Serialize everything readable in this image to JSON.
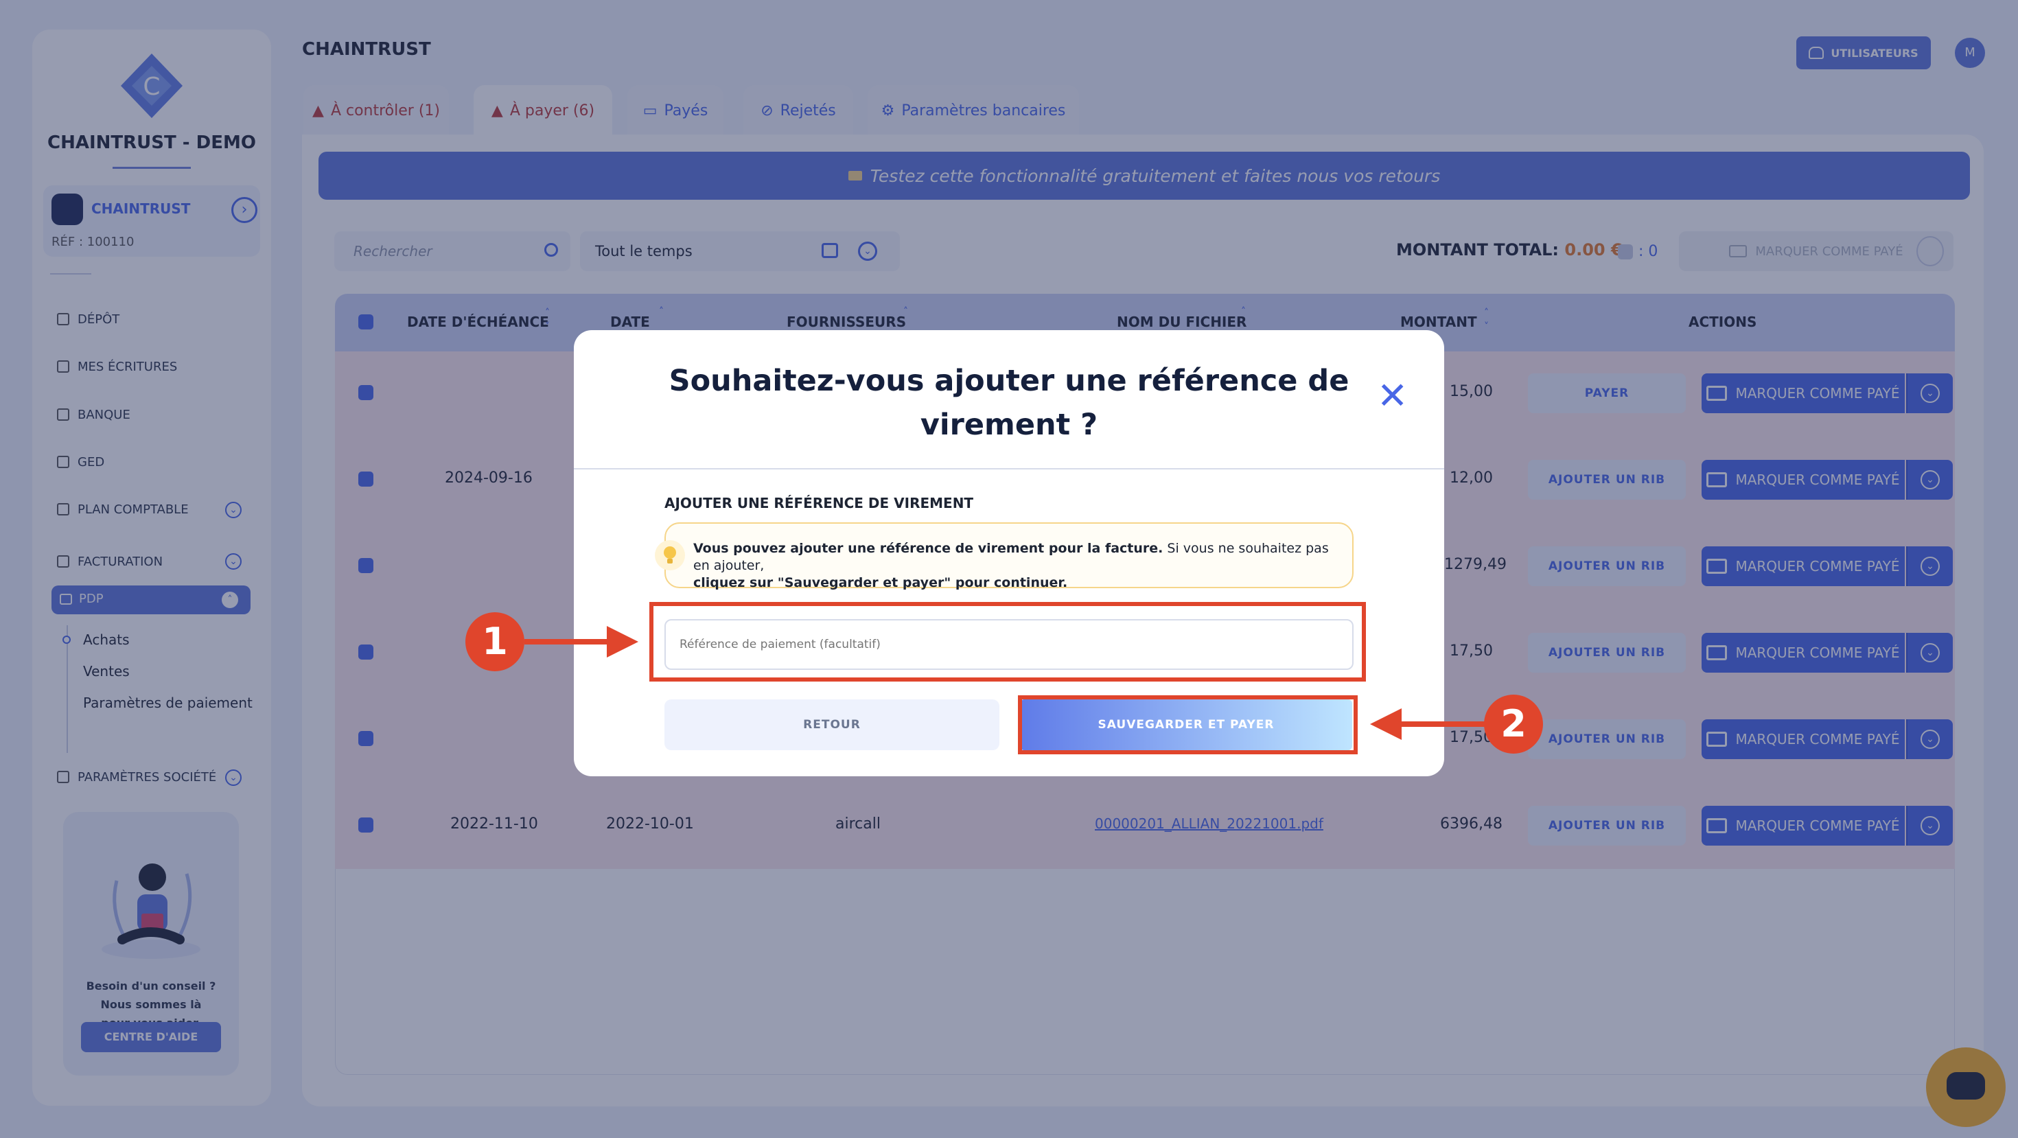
{
  "sidebar": {
    "company": "CHAINTRUST - DEMO",
    "org_name": "CHAINTRUST",
    "org_ref": "RÉF : 100110",
    "nav": [
      {
        "label": "DÉPÔT"
      },
      {
        "label": "MES ÉCRITURES"
      },
      {
        "label": "BANQUE"
      },
      {
        "label": "GED"
      },
      {
        "label": "PLAN COMPTABLE"
      },
      {
        "label": "FACTURATION"
      },
      {
        "label": "PDP"
      },
      {
        "label": "PARAMÈTRES SOCIÉTÉ"
      }
    ],
    "pdp_sub": [
      "Achats",
      "Ventes",
      "Paramètres de paiement"
    ],
    "help_line1": "Besoin d'un conseil ?",
    "help_line2": "Nous sommes là",
    "help_line3": "pour vous aider.",
    "help_button": "CENTRE D'AIDE"
  },
  "header": {
    "title": "CHAINTRUST",
    "users_button": "UTILISATEURS",
    "avatar": "M"
  },
  "tabs": [
    {
      "label": "À contrôler (1)"
    },
    {
      "label": "À payer (6)"
    },
    {
      "label": "Payés"
    },
    {
      "label": "Rejetés"
    },
    {
      "label": "Paramètres bancaires"
    }
  ],
  "banner": "Testez cette fonctionnalité gratuitement et faites nous vos retours",
  "toolbar": {
    "search_placeholder": "Rechercher",
    "period": "Tout le temps",
    "total_label": "MONTANT TOTAL:",
    "total_value": "0.00 €",
    "selected_count": ": 0",
    "mark_all": "MARQUER COMME PAYÉ"
  },
  "table": {
    "headers": [
      "DATE D'ÉCHÉANCE",
      "DATE",
      "FOURNISSEURS",
      "NOM DU FICHIER",
      "MONTANT",
      "ACTIONS"
    ],
    "rows": [
      {
        "due": "",
        "date": "",
        "supplier": "",
        "file": "",
        "amount": "15,00",
        "action": "PAYER",
        "mark": "MARQUER COMME PAYÉ"
      },
      {
        "due": "2024-09-16",
        "date": "",
        "supplier": "",
        "file": "",
        "amount": "12,00",
        "action": "AJOUTER UN RIB",
        "mark": "MARQUER COMME PAYÉ"
      },
      {
        "due": "",
        "date": "",
        "supplier": "",
        "file": "",
        "amount": "1279,49",
        "action": "AJOUTER UN RIB",
        "mark": "MARQUER COMME PAYÉ"
      },
      {
        "due": "",
        "date": "",
        "supplier": "",
        "file": "",
        "amount": "17,50",
        "action": "AJOUTER UN RIB",
        "mark": "MARQUER COMME PAYÉ"
      },
      {
        "due": "",
        "date": "",
        "supplier": "",
        "file": "",
        "amount": "17,50",
        "action": "AJOUTER UN RIB",
        "mark": "MARQUER COMME PAYÉ"
      },
      {
        "due": "2022-11-10",
        "date": "2022-10-01",
        "supplier": "aircall",
        "file": "00000201_ALLIAN_20221001.pdf",
        "amount": "6396,48",
        "action": "AJOUTER UN RIB",
        "mark": "MARQUER COMME PAYÉ"
      }
    ]
  },
  "modal": {
    "title": "Souhaitez-vous ajouter une référence de virement ?",
    "section_label": "AJOUTER UNE RÉFÉRENCE DE VIREMENT",
    "info_bold": "Vous pouvez ajouter une référence de virement pour la facture.",
    "info_normal": " Si vous ne souhaitez pas en ajouter,",
    "info_bold2": "cliquez sur \"Sauvegarder et payer\" pour continuer.",
    "input_value": "",
    "input_placeholder": "Référence de paiement (facultatif)",
    "back_button": "RETOUR",
    "save_button": "SAUVEGARDER ET PAYER"
  },
  "annotations": {
    "step1": "1",
    "step2": "2"
  },
  "colors": {
    "accent": "#4866e6",
    "highlight": "#e0452c",
    "warning_row": "#fbe9ec",
    "total_value": "#e07a2c"
  }
}
